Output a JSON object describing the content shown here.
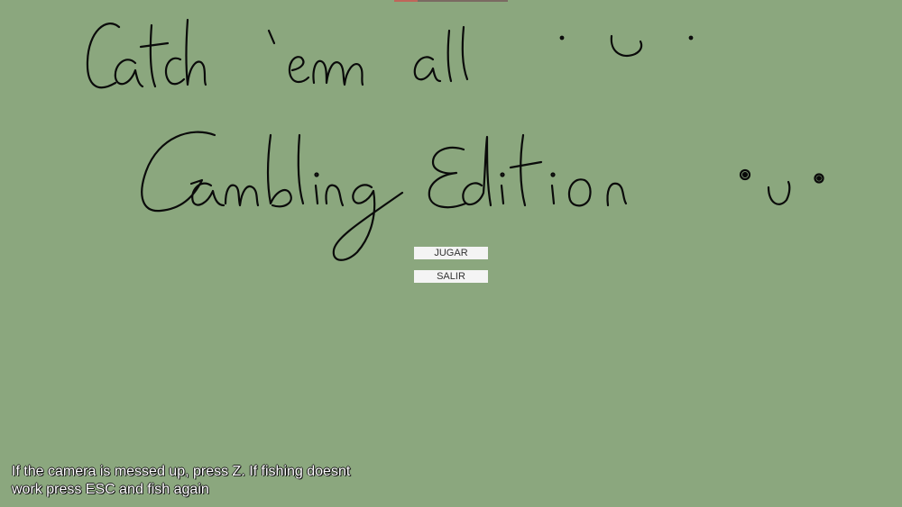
{
  "title": {
    "line1": "Catch 'em all",
    "line2": "Gambling Edition",
    "face_small": "·ᴗ·",
    "face_large": "•ᴗ•"
  },
  "menu": {
    "play_label": "JUGAR",
    "quit_label": "SALIR"
  },
  "hint": {
    "text": "If the camera is messed up, press Z. If fishing doesnt work press ESC and fish again"
  },
  "colors": {
    "background": "#8ba77e",
    "button_bg": "#f4f4f4",
    "ink": "#0a0a0a",
    "hint_text": "#ffffff"
  }
}
